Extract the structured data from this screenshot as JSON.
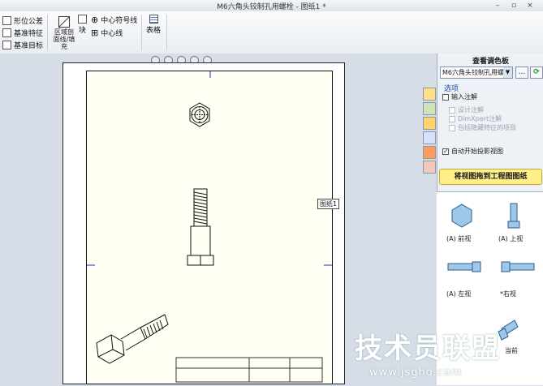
{
  "window": {
    "title": "M6六角头铰制孔用螺栓 - 图纸1 *",
    "minimize": "–",
    "restore": "▫",
    "close": "×"
  },
  "ribbon": {
    "gtol": "形位公差",
    "datum_feature": "基准特征",
    "datum_target": "基准目标",
    "area_hatch_line1": "区域剖",
    "area_hatch_line2": "面线/填",
    "area_hatch_line3": "充",
    "block": "块",
    "centermark": "中心符号线",
    "centerline": "中心线",
    "table": "表格"
  },
  "sheet": {
    "label": "图纸1"
  },
  "view_palette": {
    "title": "查看调色板",
    "model_selector": "M6六角头铰制孔用螺",
    "browse_button": "...",
    "refresh_icon": "refresh-icon",
    "options_title": "选项",
    "options": [
      {
        "label": "输入注解",
        "checked": false,
        "disabled": false
      },
      {
        "label": "设计注解",
        "checked": false,
        "disabled": true
      },
      {
        "label": "DimXpert注解",
        "checked": false,
        "disabled": true
      },
      {
        "label": "包括隐藏特征的项目",
        "checked": false,
        "disabled": true
      },
      {
        "label": "自动开始投影视图",
        "checked": true,
        "disabled": false
      }
    ],
    "drag_hint": "将视图拖到工程图图纸",
    "views": [
      "(A) 前视",
      "(A) 上视",
      "(A) 左视",
      "*右视",
      "当前"
    ]
  },
  "watermark": {
    "text": "技术员联盟",
    "url": "www.jsgho.com"
  },
  "colors": {
    "accent_yellow": "#ffef8a",
    "sheet_bg": "#fffff4",
    "panel_bg": "#eef2f6",
    "options_title": "#1f4fa5"
  }
}
